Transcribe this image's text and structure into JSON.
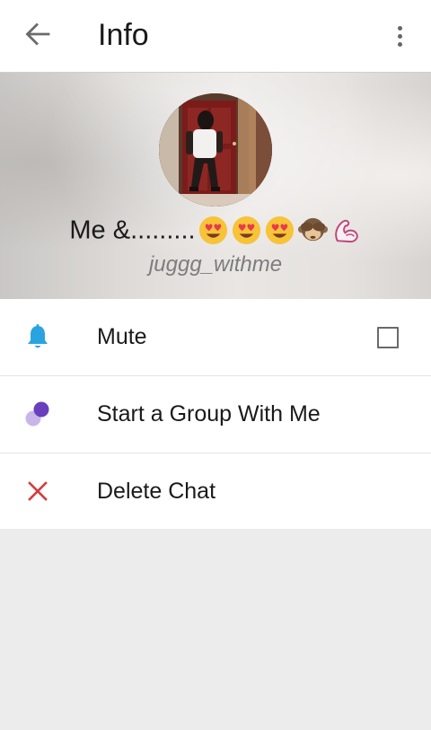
{
  "appbar": {
    "title": "Info",
    "back_icon": "arrow-left-icon",
    "menu_icon": "more-vertical-icon"
  },
  "profile": {
    "name": "Me &.........",
    "name_emojis": [
      "smiling-face-with-heart-eyes",
      "smiling-face-with-heart-eyes",
      "smiling-face-with-heart-eyes",
      "see-no-evil-monkey",
      "flexed-biceps"
    ],
    "username": "juggg_withme"
  },
  "options": [
    {
      "label": "Mute",
      "icon": "bell-icon",
      "icon_color": "#2aa4e0",
      "checked": false
    },
    {
      "label": "Start a Group With Me",
      "icon": "group-circles-icon",
      "icon_color": "#6a3fbd"
    },
    {
      "label": "Delete Chat",
      "icon": "close-x-icon",
      "icon_color": "#d83a3a"
    }
  ],
  "colors": {
    "appbar_bg": "#ffffff",
    "page_bg": "#ececec",
    "username_text": "#7d7d7d"
  }
}
